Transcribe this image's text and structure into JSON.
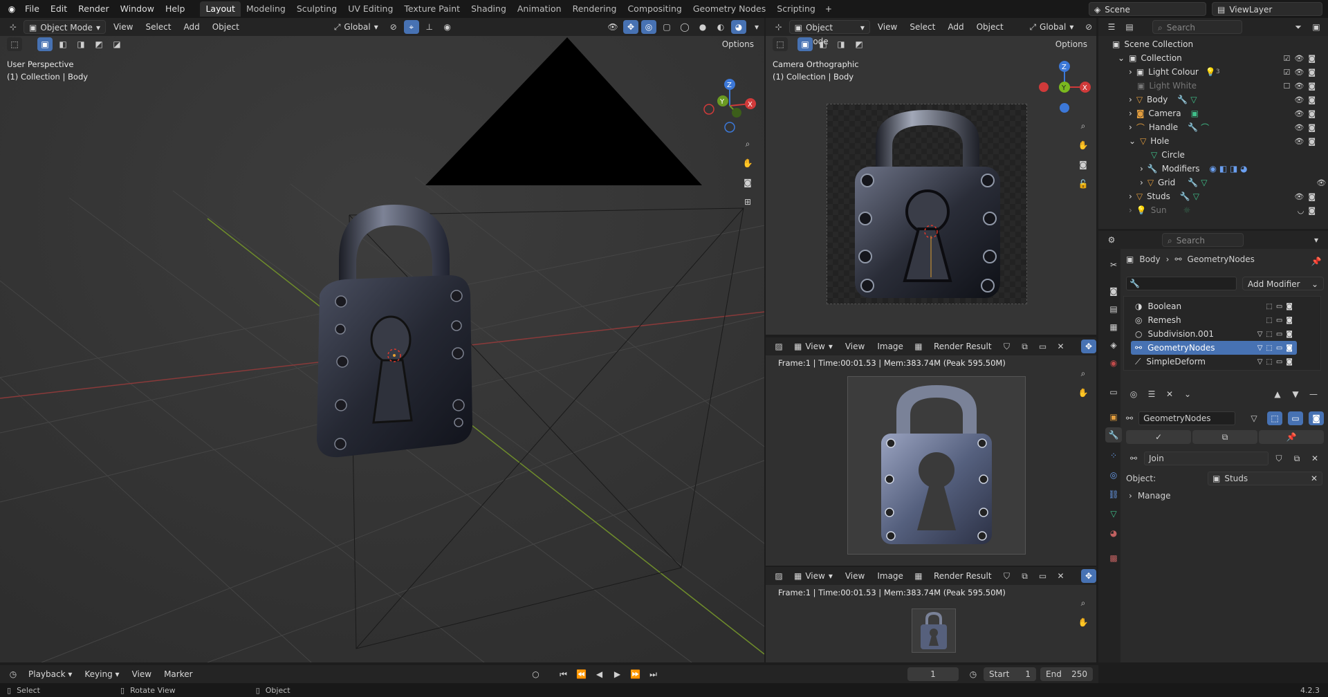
{
  "menus": [
    "File",
    "Edit",
    "Render",
    "Window",
    "Help"
  ],
  "workspaces": [
    "Layout",
    "Modeling",
    "Sculpting",
    "UV Editing",
    "Texture Paint",
    "Shading",
    "Animation",
    "Rendering",
    "Compositing",
    "Geometry Nodes",
    "Scripting"
  ],
  "scene": {
    "name": "Scene",
    "view_layer": "ViewLayer"
  },
  "viewport_left": {
    "mode": "Object Mode",
    "menus": [
      "View",
      "Select",
      "Add",
      "Object"
    ],
    "transform": "Global",
    "options": "Options",
    "perspective": "User Perspective",
    "context": "(1) Collection | Body"
  },
  "viewport_right": {
    "mode": "Object Mode",
    "menus": [
      "View",
      "Select",
      "Add",
      "Object"
    ],
    "transform": "Global",
    "options": "Options",
    "perspective": "Camera Orthographic",
    "context": "(1) Collection | Body"
  },
  "image_editor_1": {
    "view": "View",
    "menus": [
      "View",
      "Image"
    ],
    "image": "Render Result",
    "stats": "Frame:1 | Time:00:01.53 | Mem:383.74M (Peak 595.50M)"
  },
  "image_editor_2": {
    "view": "View",
    "menus": [
      "View",
      "Image"
    ],
    "image": "Render Result",
    "stats": "Frame:1 | Time:00:01.53 | Mem:383.74M (Peak 595.50M)"
  },
  "outliner": {
    "search": "Search",
    "rows": [
      {
        "label": "Scene Collection"
      },
      {
        "label": "Collection"
      },
      {
        "label": "Light Colour",
        "badge": "3"
      },
      {
        "label": "Light White"
      },
      {
        "label": "Body"
      },
      {
        "label": "Camera"
      },
      {
        "label": "Handle"
      },
      {
        "label": "Hole"
      },
      {
        "label": "Circle"
      },
      {
        "label": "Modifiers"
      },
      {
        "label": "Grid"
      },
      {
        "label": "Studs"
      },
      {
        "label": "Sun"
      }
    ]
  },
  "properties": {
    "search": "Search",
    "breadcrumb": [
      "Body",
      "GeometryNodes"
    ],
    "add_modifier": "Add Modifier",
    "modifiers": [
      "Boolean",
      "Remesh",
      "Subdivision.001",
      "GeometryNodes",
      "SimpleDeform"
    ],
    "selected_modifier": "GeometryNodes",
    "node_group": "GeometryNodes",
    "node_group_name": "Join",
    "object_label": "Object:",
    "object_value": "Studs",
    "manage": "Manage"
  },
  "timeline": {
    "menus": [
      "Playback",
      "Keying",
      "View",
      "Marker"
    ],
    "current_frame": "1",
    "start_label": "Start",
    "start": "1",
    "end_label": "End",
    "end": "250"
  },
  "status": {
    "select": "Select",
    "rotate": "Rotate View",
    "object": "Object",
    "version": "4.2.3"
  }
}
